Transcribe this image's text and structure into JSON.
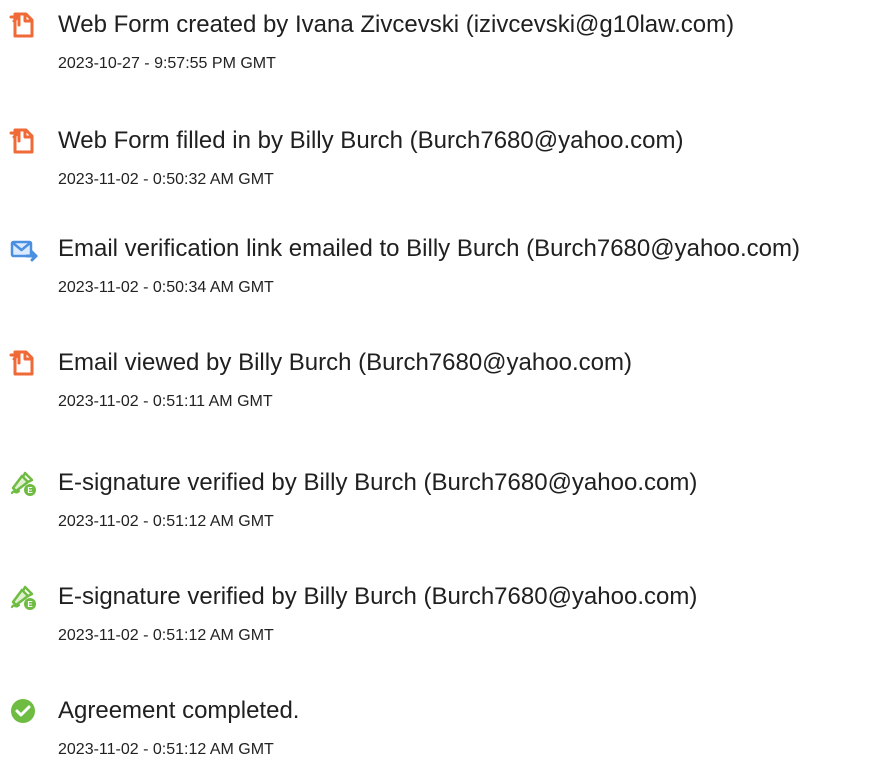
{
  "colors": {
    "orange_icon": "#f06a37",
    "blue_icon": "#4a8fe0",
    "green_icon": "#6fbc42",
    "text": "#202020"
  },
  "events": [
    {
      "icon": "document-icon",
      "title": "Web Form created by Ivana Zivcevski (izivcevski@g10law.com)",
      "time": "2023-10-27 - 9:57:55 PM GMT"
    },
    {
      "icon": "document-icon",
      "title": "Web Form filled in by Billy Burch (Burch7680@yahoo.com)",
      "time": "2023-11-02 - 0:50:32 AM GMT"
    },
    {
      "icon": "email-arrow-icon",
      "title": "Email verification link emailed to Billy Burch (Burch7680@yahoo.com)",
      "time": "2023-11-02 - 0:50:34 AM GMT"
    },
    {
      "icon": "document-icon",
      "title": "Email viewed by Billy Burch (Burch7680@yahoo.com)",
      "time": "2023-11-02 - 0:51:11 AM GMT"
    },
    {
      "icon": "signature-pen-icon",
      "title": "E-signature verified by Billy Burch (Burch7680@yahoo.com)",
      "time": "2023-11-02 - 0:51:12 AM GMT"
    },
    {
      "icon": "signature-pen-icon",
      "title": "E-signature verified by Billy Burch (Burch7680@yahoo.com)",
      "time": "2023-11-02 - 0:51:12 AM GMT"
    },
    {
      "icon": "checkmark-circle-icon",
      "title": "Agreement completed.",
      "time": "2023-11-02 - 0:51:12 AM GMT"
    }
  ]
}
